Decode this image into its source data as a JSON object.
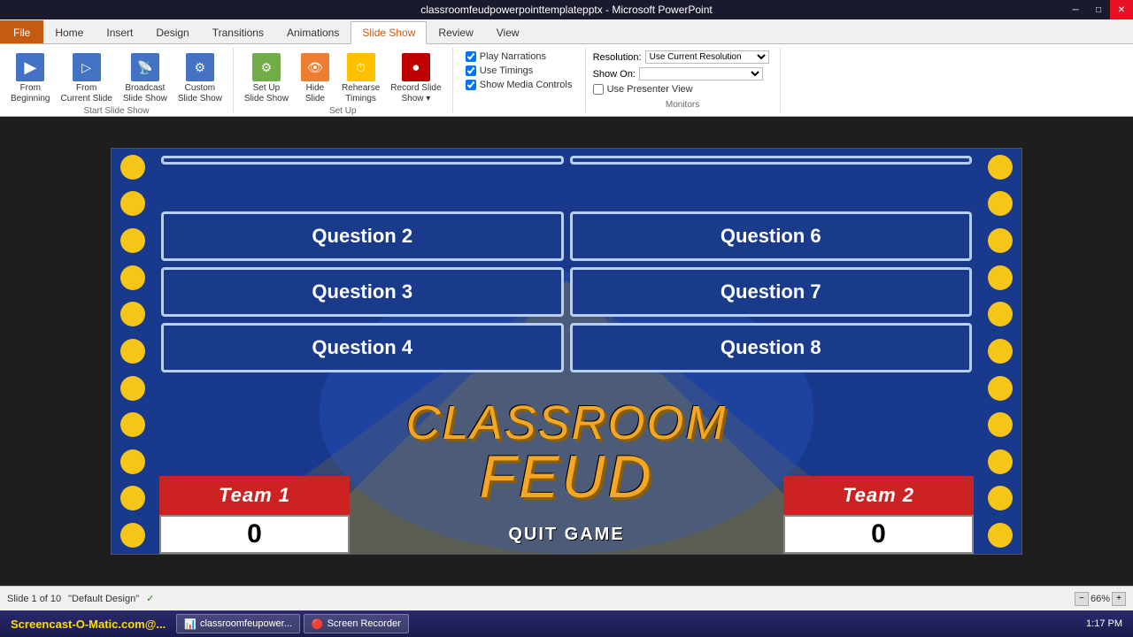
{
  "titlebar": {
    "title": "classroomfeudpowerpointtemplatepptx - Microsoft PowerPoint",
    "min": "─",
    "max": "□",
    "close": "✕"
  },
  "ribbon": {
    "tabs": [
      "File",
      "Home",
      "Insert",
      "Design",
      "Transitions",
      "Animations",
      "Slide Show",
      "Review",
      "View"
    ],
    "active_tab": "Slide Show",
    "groups": {
      "start_slideshow": {
        "label": "Start Slide Show",
        "buttons": [
          {
            "label": "From Beginning",
            "icon": "▶"
          },
          {
            "label": "From Current Slide",
            "icon": "▷"
          },
          {
            "label": "Broadcast Slide Show",
            "icon": "📡"
          },
          {
            "label": "Custom Slide Show",
            "icon": "⚙"
          }
        ]
      },
      "setup": {
        "label": "Set Up",
        "buttons": [
          {
            "label": "Set Up Slide Show",
            "icon": "⚙"
          },
          {
            "label": "Hide Slide",
            "icon": "👁"
          },
          {
            "label": "Rehearse Timings",
            "icon": "⏱"
          },
          {
            "label": "Record Slide Show",
            "icon": "⏺"
          }
        ]
      },
      "checkboxes": {
        "play_narrations": "Play Narrations",
        "use_timings": "Use Timings",
        "show_media_controls": "Show Media Controls"
      },
      "monitors": {
        "label": "Monitors",
        "resolution_label": "Resolution:",
        "resolution_value": "Use Current Resolution",
        "show_on_label": "Show On:",
        "show_on_value": "",
        "presenter_view_label": "Use Presenter View"
      }
    }
  },
  "slide": {
    "questions": [
      {
        "label": "Question 2",
        "col": 1
      },
      {
        "label": "Question 6",
        "col": 2
      },
      {
        "label": "Question 3",
        "col": 1
      },
      {
        "label": "Question 7",
        "col": 2
      },
      {
        "label": "Question 4",
        "col": 1
      },
      {
        "label": "Question 8",
        "col": 2
      }
    ],
    "title_line1": "CLASSROOM",
    "title_line2": "FEUD",
    "team1": {
      "name": "Team 1",
      "score": "0"
    },
    "team2": {
      "name": "Team 2",
      "score": "0"
    },
    "quit_btn": "QUIT GAME"
  },
  "statusbar": {
    "slide_info": "Slide 1 of 10",
    "theme": "\"Default Design\"",
    "check": "✓",
    "zoom": "66%"
  },
  "taskbar": {
    "brand": "Screencast-O-Matic.com@...",
    "items": [
      {
        "icon": "📊",
        "label": "classroomfeupower..."
      },
      {
        "icon": "🔴",
        "label": "Screen Recorder"
      }
    ],
    "time": "1:17 PM"
  }
}
